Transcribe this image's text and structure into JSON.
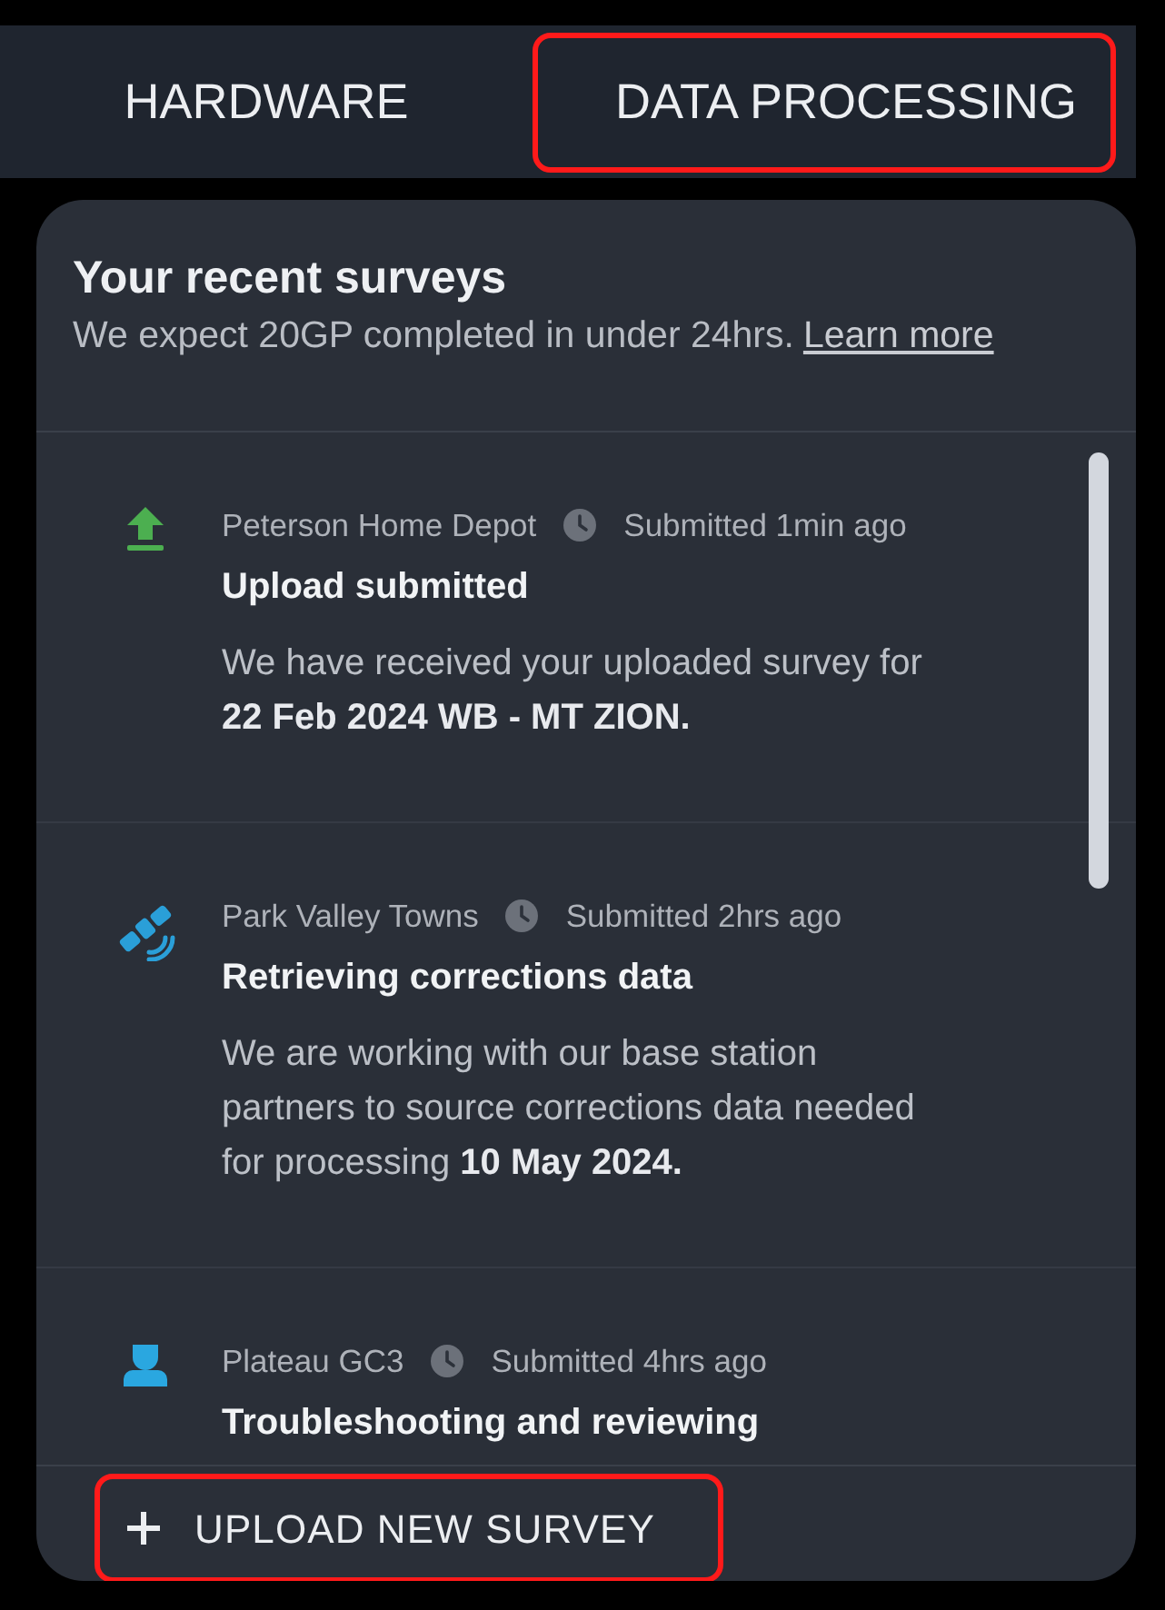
{
  "tabs": [
    {
      "label": "HARDWARE",
      "highlighted": false
    },
    {
      "label": "DATA PROCESSING",
      "highlighted": true
    }
  ],
  "surveys_panel": {
    "title": "Your recent surveys",
    "subtitle": "We expect 20GP completed in under 24hrs.",
    "link": "Learn more",
    "items": [
      {
        "kind": "upload",
        "site": "Peterson Home Depot",
        "time": "Submitted 1min ago",
        "title": "Upload submitted",
        "description": "We have received your uploaded survey for **22 Feb 2024 WB - MT ZION.**"
      },
      {
        "kind": "satellite",
        "site": "Park Valley Towns",
        "time": "Submitted 2hrs ago",
        "title": "Retrieving corrections data",
        "description": "We are working with our base station partners to source corrections data needed for processing **10 May 2024.**"
      },
      {
        "kind": "person",
        "site": "Plateau GC3",
        "time": "Submitted 4hrs ago",
        "title": "Troubleshooting and reviewing"
      }
    ],
    "upload_button": {
      "label": "UPLOAD NEW SURVEY",
      "highlighted": true
    }
  }
}
